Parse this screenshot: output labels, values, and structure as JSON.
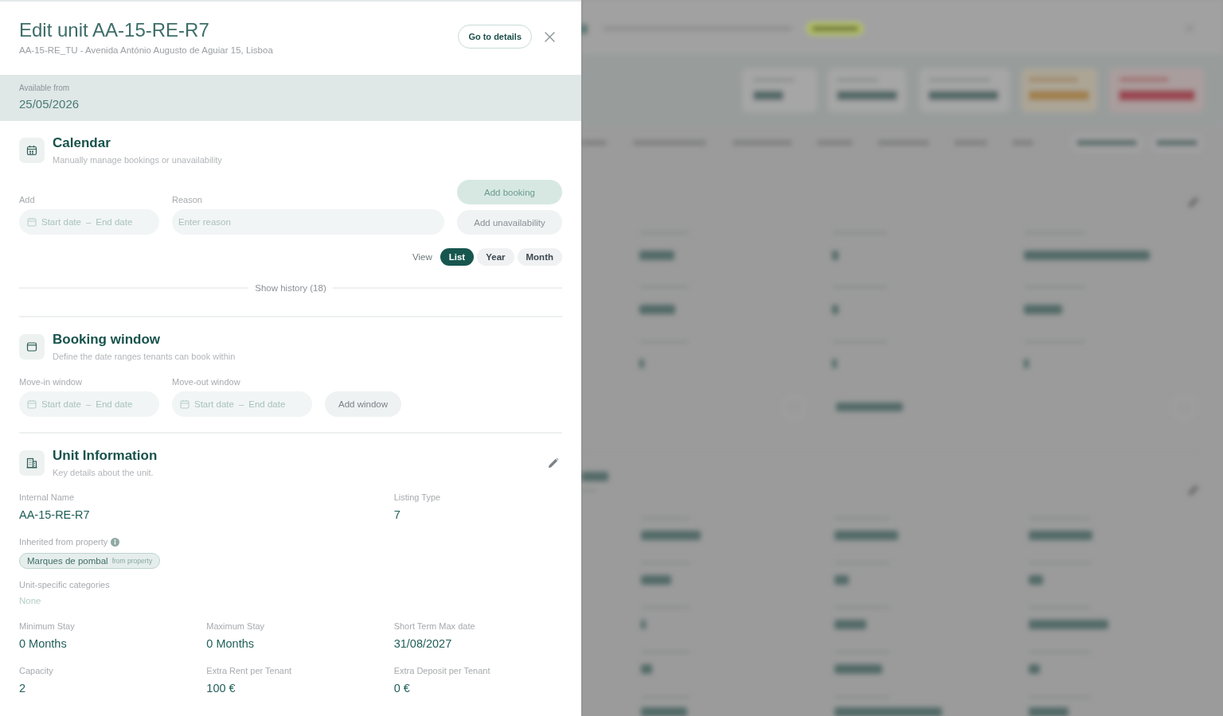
{
  "drawer": {
    "title": "Edit unit AA-15-RE-R7",
    "subtitle": "AA-15-RE_TU - Avenida António Augusto de Aguiar 15, Lisboa",
    "details_button": "Go to details",
    "availability": {
      "label": "Available from",
      "value": "25/05/2026"
    },
    "calendar": {
      "title": "Calendar",
      "subtitle": "Manually manage bookings or unavailability",
      "date_range": {
        "label": "Add",
        "start_placeholder": "Start date",
        "separator": "–",
        "end_placeholder": "End date"
      },
      "reason": {
        "label": "Reason",
        "placeholder": "Enter reason"
      },
      "actions": [
        {
          "label": "Add booking",
          "kind": "primary"
        },
        {
          "label": "Add unavailability",
          "kind": "secondary"
        }
      ],
      "view": {
        "label": "View",
        "options": [
          {
            "label": "List",
            "selected": true
          },
          {
            "label": "Year",
            "selected": false
          },
          {
            "label": "Month",
            "selected": false
          }
        ]
      },
      "history_toggle": "Show history (18)"
    },
    "booking_window": {
      "title": "Booking window",
      "subtitle": "Define the date ranges tenants can book within",
      "windows": [
        {
          "label": "Move-in window",
          "start_placeholder": "Start date",
          "separator": "–",
          "end_placeholder": "End date"
        },
        {
          "label": "Move-out window",
          "start_placeholder": "Start date",
          "separator": "–",
          "end_placeholder": "End date"
        }
      ],
      "add_button": "Add window"
    },
    "unit_information": {
      "title": "Unit Information",
      "subtitle": "Key details about the unit.",
      "identity": [
        {
          "label": "Internal Name",
          "value": "AA-15-RE-R7"
        },
        {
          "label": "Listing Type",
          "value": "7"
        }
      ],
      "inherited": {
        "label": "Inherited from property",
        "tags": [
          {
            "name": "Marques de pombal",
            "source": "from property"
          }
        ]
      },
      "unit_categories": {
        "label": "Unit-specific categories",
        "value": "None"
      },
      "details": [
        {
          "label": "Minimum Stay",
          "value": "0 Months"
        },
        {
          "label": "Maximum Stay",
          "value": "0 Months"
        },
        {
          "label": "Short Term Max date",
          "value": "31/08/2027"
        },
        {
          "label": "Capacity",
          "value": "2"
        },
        {
          "label": "Extra Rent per Tenant",
          "value": "100 €"
        },
        {
          "label": "Extra Deposit per Tenant",
          "value": "0 €"
        }
      ]
    }
  }
}
